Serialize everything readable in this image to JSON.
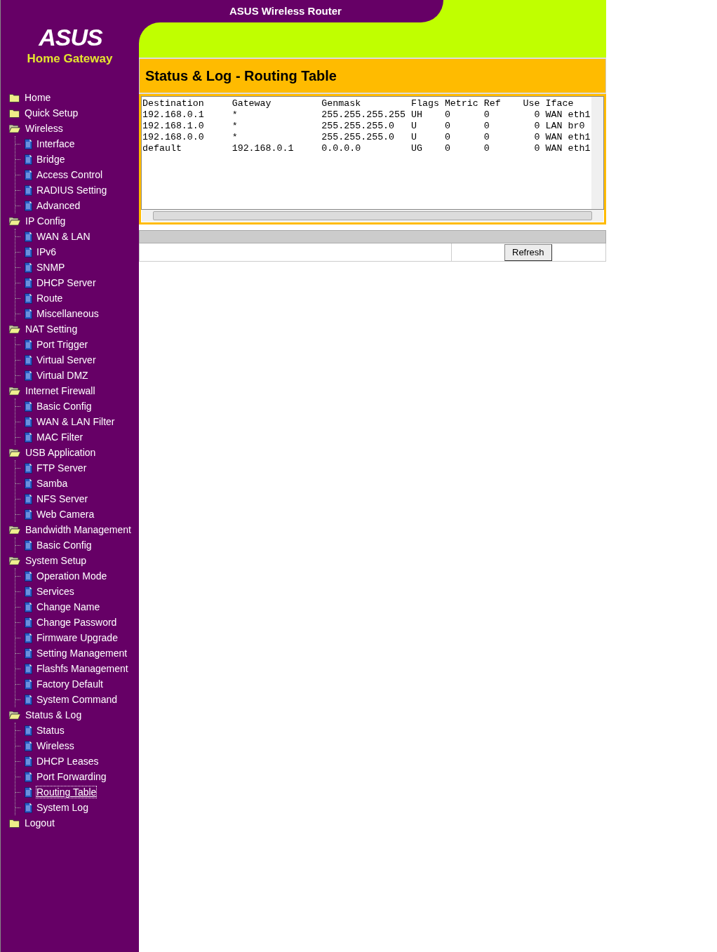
{
  "header": {
    "title": "ASUS Wireless Router",
    "logo": "ASUS",
    "subtitle": "Home Gateway"
  },
  "sidebar": {
    "items": [
      {
        "label": "Home",
        "kind": "folder",
        "expanded": false,
        "selected": false
      },
      {
        "label": "Quick Setup",
        "kind": "folder",
        "expanded": false,
        "selected": false
      },
      {
        "label": "Wireless",
        "kind": "folder",
        "expanded": true,
        "selected": false,
        "children": [
          {
            "label": "Interface",
            "kind": "page",
            "selected": false
          },
          {
            "label": "Bridge",
            "kind": "page",
            "selected": false
          },
          {
            "label": "Access Control",
            "kind": "page",
            "selected": false
          },
          {
            "label": "RADIUS Setting",
            "kind": "page",
            "selected": false
          },
          {
            "label": "Advanced",
            "kind": "page",
            "selected": false
          }
        ]
      },
      {
        "label": "IP Config",
        "kind": "folder",
        "expanded": true,
        "selected": false,
        "children": [
          {
            "label": "WAN & LAN",
            "kind": "page",
            "selected": false
          },
          {
            "label": "IPv6",
            "kind": "page",
            "selected": false
          },
          {
            "label": "SNMP",
            "kind": "page",
            "selected": false
          },
          {
            "label": "DHCP Server",
            "kind": "page",
            "selected": false
          },
          {
            "label": "Route",
            "kind": "page",
            "selected": false
          },
          {
            "label": "Miscellaneous",
            "kind": "page",
            "selected": false
          }
        ]
      },
      {
        "label": "NAT Setting",
        "kind": "folder",
        "expanded": true,
        "selected": false,
        "children": [
          {
            "label": "Port Trigger",
            "kind": "page",
            "selected": false
          },
          {
            "label": "Virtual Server",
            "kind": "page",
            "selected": false
          },
          {
            "label": "Virtual DMZ",
            "kind": "page",
            "selected": false
          }
        ]
      },
      {
        "label": "Internet Firewall",
        "kind": "folder",
        "expanded": true,
        "selected": false,
        "children": [
          {
            "label": "Basic Config",
            "kind": "page",
            "selected": false
          },
          {
            "label": "WAN & LAN Filter",
            "kind": "page",
            "selected": false
          },
          {
            "label": "MAC Filter",
            "kind": "page",
            "selected": false
          }
        ]
      },
      {
        "label": "USB Application",
        "kind": "folder",
        "expanded": true,
        "selected": false,
        "children": [
          {
            "label": "FTP Server",
            "kind": "page",
            "selected": false
          },
          {
            "label": "Samba",
            "kind": "page",
            "selected": false
          },
          {
            "label": "NFS Server",
            "kind": "page",
            "selected": false
          },
          {
            "label": "Web Camera",
            "kind": "page",
            "selected": false
          }
        ]
      },
      {
        "label": "Bandwidth Management",
        "kind": "folder",
        "expanded": true,
        "selected": false,
        "children": [
          {
            "label": "Basic Config",
            "kind": "page",
            "selected": false
          }
        ]
      },
      {
        "label": "System Setup",
        "kind": "folder",
        "expanded": true,
        "selected": false,
        "children": [
          {
            "label": "Operation Mode",
            "kind": "page",
            "selected": false
          },
          {
            "label": "Services",
            "kind": "page",
            "selected": false
          },
          {
            "label": "Change Name",
            "kind": "page",
            "selected": false
          },
          {
            "label": "Change Password",
            "kind": "page",
            "selected": false
          },
          {
            "label": "Firmware Upgrade",
            "kind": "page",
            "selected": false
          },
          {
            "label": "Setting Management",
            "kind": "page",
            "selected": false
          },
          {
            "label": "Flashfs Management",
            "kind": "page",
            "selected": false
          },
          {
            "label": "Factory Default",
            "kind": "page",
            "selected": false
          },
          {
            "label": "System Command",
            "kind": "page",
            "selected": false
          }
        ]
      },
      {
        "label": "Status & Log",
        "kind": "folder",
        "expanded": true,
        "selected": false,
        "children": [
          {
            "label": "Status",
            "kind": "page",
            "selected": false
          },
          {
            "label": "Wireless",
            "kind": "page",
            "selected": false
          },
          {
            "label": "DHCP Leases",
            "kind": "page",
            "selected": false
          },
          {
            "label": "Port Forwarding",
            "kind": "page",
            "selected": false
          },
          {
            "label": "Routing Table",
            "kind": "page",
            "selected": true
          },
          {
            "label": "System Log",
            "kind": "page",
            "selected": false
          }
        ]
      },
      {
        "label": "Logout",
        "kind": "folder",
        "expanded": false,
        "selected": false
      }
    ]
  },
  "page": {
    "title": "Status & Log - Routing Table",
    "log_lines": [
      "Destination     Gateway         Genmask         Flags Metric Ref    Use Iface",
      "192.168.0.1     *               255.255.255.255 UH    0      0        0 WAN eth1",
      "192.168.1.0     *               255.255.255.0   U     0      0        0 LAN br0",
      "192.168.0.0     *               255.255.255.0   U     0      0        0 WAN eth1",
      "default         192.168.0.1     0.0.0.0         UG    0      0        0 WAN eth1"
    ],
    "buttons": [
      "Refresh"
    ]
  }
}
